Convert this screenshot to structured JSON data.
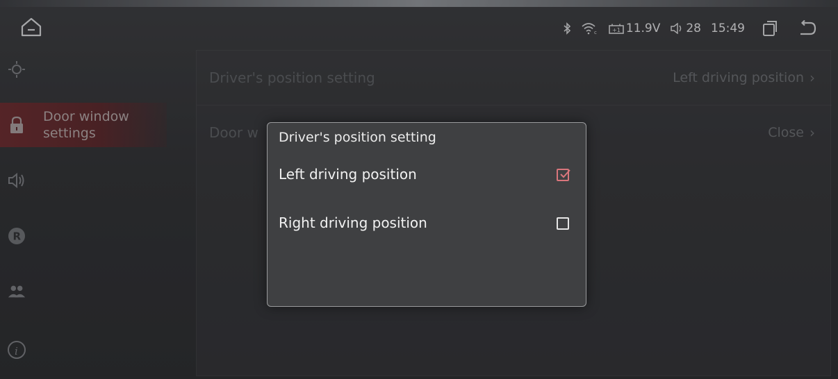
{
  "status": {
    "voltage": "11.9V",
    "volume": "28",
    "time": "15:49"
  },
  "sidebar": {
    "items": [
      {
        "label": "",
        "icon": "sun-icon"
      },
      {
        "label": "Door window settings",
        "icon": "lock-icon",
        "active": true
      },
      {
        "label": "",
        "icon": "speaker-icon"
      },
      {
        "label": "",
        "icon": "r-circle-icon"
      },
      {
        "label": "",
        "icon": "people-icon"
      },
      {
        "label": "",
        "icon": "info-icon"
      }
    ]
  },
  "main": {
    "rows": [
      {
        "label": "Driver's position setting",
        "value": "Left driving position"
      },
      {
        "label": "Door w",
        "value": "Close"
      }
    ]
  },
  "dialog": {
    "title": "Driver's position setting",
    "options": [
      {
        "label": "Left driving position",
        "checked": true
      },
      {
        "label": "Right driving position",
        "checked": false
      }
    ]
  },
  "colors": {
    "accent": "#d9767c",
    "active_sidebar": "#6b2a2c"
  }
}
